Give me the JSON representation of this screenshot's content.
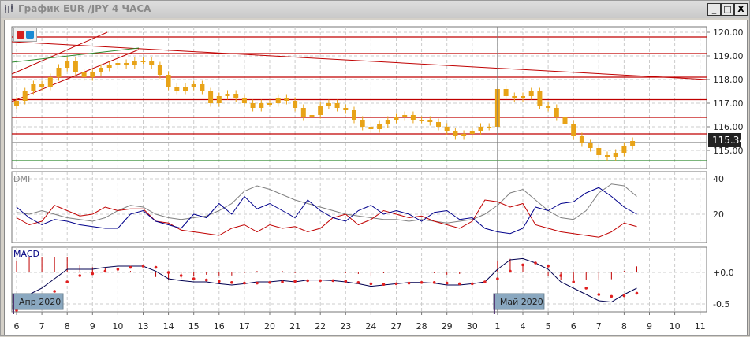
{
  "window": {
    "title": "График EUR /JPY  4 ЧАСА",
    "minimize": "_",
    "maximize": "□",
    "close": "X"
  },
  "colors": {
    "candle": "#e8a317",
    "level": "#c00000",
    "trend_green": "#2e8b2e",
    "plus_di": "#00008b",
    "minus_di": "#c00000",
    "adx": "#808080",
    "macd": "#000050",
    "signal": "#e02020",
    "price_tag_bg": "#222222"
  },
  "price_panel": {
    "axis_labels": [
      "120.00",
      "119.00",
      "118.00",
      "117.00",
      "116.00",
      "115.00"
    ],
    "axis_values": [
      120,
      119,
      118,
      117,
      116,
      115
    ],
    "current_price": "115.34",
    "current_value": 115.34,
    "levels": [
      119.8,
      119.1,
      118.1,
      117.15,
      116.4,
      115.7
    ],
    "support_green": 114.57,
    "closes": [
      117.1,
      117.5,
      117.8,
      117.7,
      118.1,
      118.5,
      118.8,
      118.3,
      118.1,
      118.3,
      118.5,
      118.6,
      118.7,
      118.6,
      118.8,
      118.8,
      118.6,
      118.2,
      117.7,
      117.5,
      117.7,
      117.8,
      117.5,
      117.0,
      117.3,
      117.4,
      117.2,
      117.0,
      116.8,
      117.0,
      117.0,
      117.2,
      117.1,
      116.8,
      116.4,
      116.5,
      116.9,
      117.0,
      116.8,
      116.7,
      116.3,
      116.0,
      115.9,
      116.1,
      116.3,
      116.4,
      116.5,
      116.3,
      116.3,
      116.2,
      116.0,
      115.8,
      115.6,
      115.7,
      115.8,
      116.0,
      116.0,
      117.6,
      117.3,
      117.2,
      117.3,
      117.5,
      116.9,
      116.8,
      116.4,
      116.1,
      115.6,
      115.3,
      115.1,
      114.8,
      114.7,
      114.9,
      115.2,
      115.4
    ]
  },
  "dmi_panel": {
    "label": "DMI",
    "axis_labels": [
      "40",
      "20"
    ],
    "axis_values": [
      40,
      20
    ],
    "plus_di": [
      24,
      18,
      14,
      17,
      16,
      14,
      13,
      12,
      12,
      20,
      22,
      16,
      14,
      12,
      20,
      18,
      26,
      20,
      30,
      23,
      26,
      22,
      18,
      28,
      22,
      18,
      16,
      22,
      25,
      20,
      22,
      20,
      16,
      21,
      22,
      17,
      18,
      12,
      10,
      9,
      12,
      24,
      22,
      26,
      27,
      32,
      35,
      30,
      24,
      20
    ],
    "minus_di": [
      18,
      14,
      16,
      25,
      22,
      19,
      20,
      24,
      22,
      23,
      23,
      16,
      15,
      11,
      10,
      9,
      8,
      12,
      14,
      10,
      14,
      12,
      13,
      10,
      12,
      18,
      20,
      14,
      17,
      22,
      20,
      18,
      19,
      16,
      14,
      12,
      16,
      28,
      27,
      24,
      26,
      14,
      12,
      10,
      9,
      8,
      7,
      10,
      15,
      13
    ],
    "adx": [
      21,
      20,
      22,
      20,
      18,
      17,
      16,
      18,
      22,
      25,
      24,
      20,
      18,
      17,
      18,
      19,
      22,
      26,
      33,
      36,
      34,
      31,
      28,
      26,
      24,
      22,
      20,
      19,
      18,
      17,
      17,
      16,
      17,
      16,
      15,
      16,
      17,
      20,
      25,
      32,
      34,
      28,
      22,
      18,
      17,
      22,
      32,
      37,
      36,
      30
    ]
  },
  "macd_panel": {
    "label": "MACD",
    "axis_labels": [
      "+0.0",
      "-0.5"
    ],
    "axis_values": [
      0,
      -0.5
    ],
    "macd": [
      -0.45,
      -0.35,
      -0.25,
      -0.1,
      0.05,
      0.05,
      0.05,
      0.08,
      0.1,
      0.1,
      0.1,
      0.02,
      -0.1,
      -0.13,
      -0.15,
      -0.15,
      -0.18,
      -0.2,
      -0.18,
      -0.15,
      -0.15,
      -0.13,
      -0.15,
      -0.12,
      -0.12,
      -0.13,
      -0.15,
      -0.18,
      -0.22,
      -0.2,
      -0.18,
      -0.16,
      -0.16,
      -0.17,
      -0.2,
      -0.2,
      -0.18,
      -0.15,
      0.05,
      0.2,
      0.22,
      0.15,
      0.05,
      -0.15,
      -0.25,
      -0.35,
      -0.45,
      -0.47,
      -0.35,
      -0.25
    ],
    "signal": [
      -0.6,
      -0.55,
      -0.45,
      -0.3,
      -0.15,
      -0.05,
      -0.02,
      0.02,
      0.05,
      0.08,
      0.1,
      0.08,
      0.0,
      -0.05,
      -0.1,
      -0.12,
      -0.14,
      -0.16,
      -0.17,
      -0.17,
      -0.16,
      -0.15,
      -0.14,
      -0.13,
      -0.13,
      -0.13,
      -0.14,
      -0.16,
      -0.18,
      -0.19,
      -0.18,
      -0.17,
      -0.16,
      -0.16,
      -0.17,
      -0.18,
      -0.18,
      -0.15,
      -0.1,
      0.02,
      0.12,
      0.15,
      0.1,
      -0.05,
      -0.15,
      -0.25,
      -0.35,
      -0.38,
      -0.37,
      -0.33
    ]
  },
  "time_axis": {
    "labels": [
      "6",
      "7",
      "8",
      "9",
      "10",
      "13",
      "14",
      "15",
      "16",
      "17",
      "20",
      "21",
      "22",
      "23",
      "24",
      "27",
      "28",
      "29",
      "30",
      "1",
      "4",
      "5",
      "6",
      "7",
      "8",
      "9",
      "10",
      "11"
    ],
    "month_tags": [
      {
        "label": "Апр 2020",
        "day_index": 0
      },
      {
        "label": "Май 2020",
        "day_index": 19
      }
    ]
  }
}
